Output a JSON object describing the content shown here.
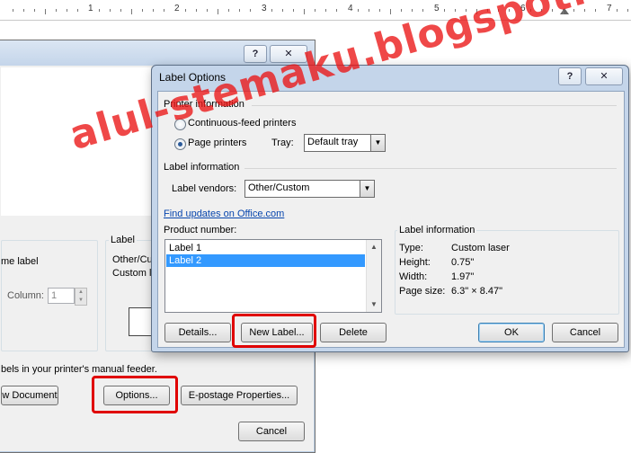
{
  "ruler": {
    "numbers": [
      "1",
      "2",
      "3",
      "4",
      "5",
      "6",
      "7"
    ]
  },
  "background_dialog": {
    "help_icon": "?",
    "close_icon": "✕",
    "name_label_fragment": "me label",
    "column_label": "Column:",
    "column_value": "1",
    "label_group_title": "Label",
    "label_group_line1": "Other/Cu",
    "label_group_line2": "Custom la",
    "feeder_text": "bels in your printer's manual feeder.",
    "new_document_button": "w Document",
    "options_button": "Options...",
    "epostage_button": "E-postage Properties...",
    "cancel_button": "Cancel"
  },
  "label_options_dialog": {
    "title": "Label Options",
    "help_icon": "?",
    "close_icon": "✕",
    "printer_information_title": "Printer information",
    "continuous_feed_label": "Continuous-feed printers",
    "page_printers_label": "Page printers",
    "tray_label": "Tray:",
    "tray_value": "Default tray",
    "label_information_title": "Label information",
    "label_vendors_label": "Label vendors:",
    "label_vendors_value": "Other/Custom",
    "find_updates_link": "Find updates on Office.com",
    "product_number_label": "Product number:",
    "product_items": [
      "Label 1",
      "Label 2"
    ],
    "selected_index": 1,
    "details_group_title": "Label information",
    "details": [
      {
        "key": "Type:",
        "value": "Custom laser"
      },
      {
        "key": "Height:",
        "value": "0.75\""
      },
      {
        "key": "Width:",
        "value": "1.97\""
      },
      {
        "key": "Page size:",
        "value": "6.3\" × 8.47\""
      }
    ],
    "details_button": "Details...",
    "new_label_button": "New Label...",
    "delete_button": "Delete",
    "ok_button": "OK",
    "cancel_button": "Cancel"
  },
  "watermark": "alul-stemaku.blogspot.com",
  "colors": {
    "highlight_box": "#e00000",
    "selection": "#3399ff",
    "link": "#0645ad"
  }
}
